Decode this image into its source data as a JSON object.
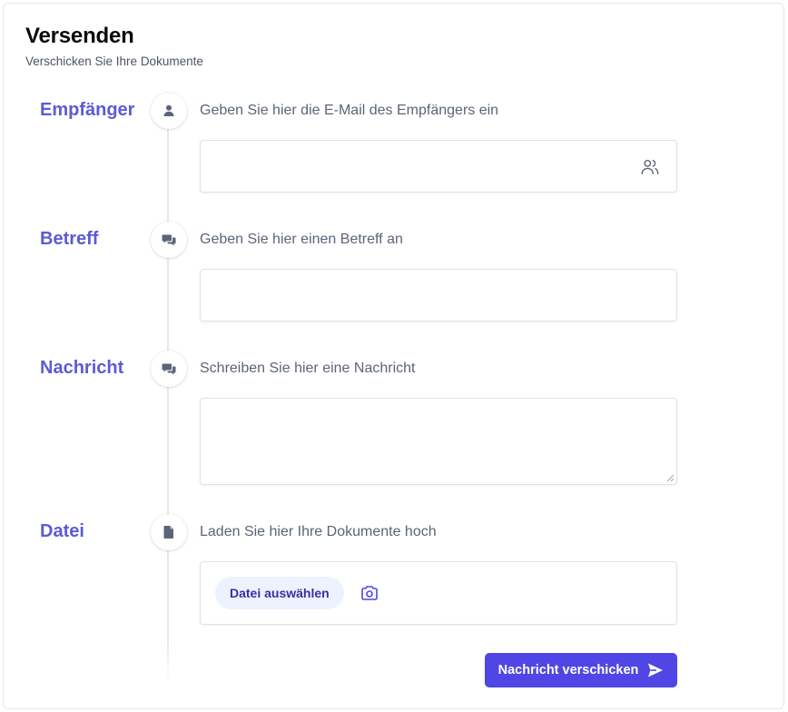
{
  "header": {
    "title": "Versenden",
    "subtitle": "Verschicken Sie Ihre Dokumente"
  },
  "steps": [
    {
      "label": "Empfänger",
      "description": "Geben Sie hier die E-Mail des Empfängers ein",
      "icon": "user-icon",
      "input_value": "",
      "input_icon": "users-icon"
    },
    {
      "label": "Betreff",
      "description": "Geben Sie hier einen Betreff an",
      "icon": "chat-icon",
      "input_value": ""
    },
    {
      "label": "Nachricht",
      "description": "Schreiben Sie hier eine Nachricht",
      "icon": "chat-icon",
      "input_value": ""
    },
    {
      "label": "Datei",
      "description": "Laden Sie hier Ihre Dokumente hoch",
      "icon": "document-icon",
      "file_button_label": "Datei auswählen",
      "file_extra_icon": "camera-icon"
    }
  ],
  "actions": {
    "send_label": "Nachricht verschicken",
    "send_icon": "paper-plane-icon"
  },
  "colors": {
    "accent": "#4f46e5",
    "label": "#5b5bd6",
    "muted_text": "#5b6577",
    "chip_bg": "#eef2ff",
    "chip_text": "#3730a3"
  }
}
